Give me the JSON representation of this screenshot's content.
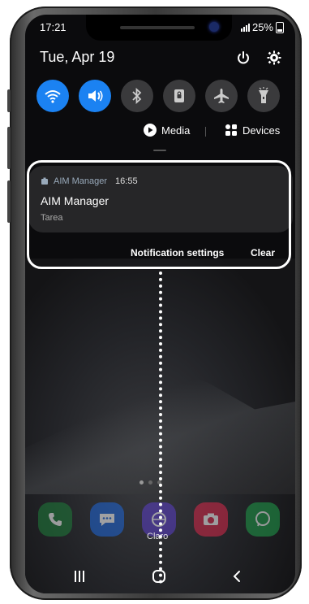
{
  "status": {
    "time": "17:21",
    "battery": "25%"
  },
  "quick_panel": {
    "date": "Tue, Apr 19",
    "tiles": [
      {
        "name": "wifi",
        "on": true
      },
      {
        "name": "sound",
        "on": true
      },
      {
        "name": "bluetooth",
        "on": false
      },
      {
        "name": "portrait-lock",
        "on": false
      },
      {
        "name": "airplane-mode",
        "on": false
      },
      {
        "name": "flashlight",
        "on": false
      }
    ],
    "media_label": "Media",
    "devices_label": "Devices"
  },
  "notification": {
    "app_name": "AIM Manager",
    "time": "16:55",
    "title": "AIM Manager",
    "text": "Tarea",
    "settings_label": "Notification settings",
    "clear_label": "Clear"
  },
  "home": {
    "dock_label": "Claro"
  },
  "colors": {
    "accent": "#1b82f2",
    "highlight": "#ffffff"
  }
}
